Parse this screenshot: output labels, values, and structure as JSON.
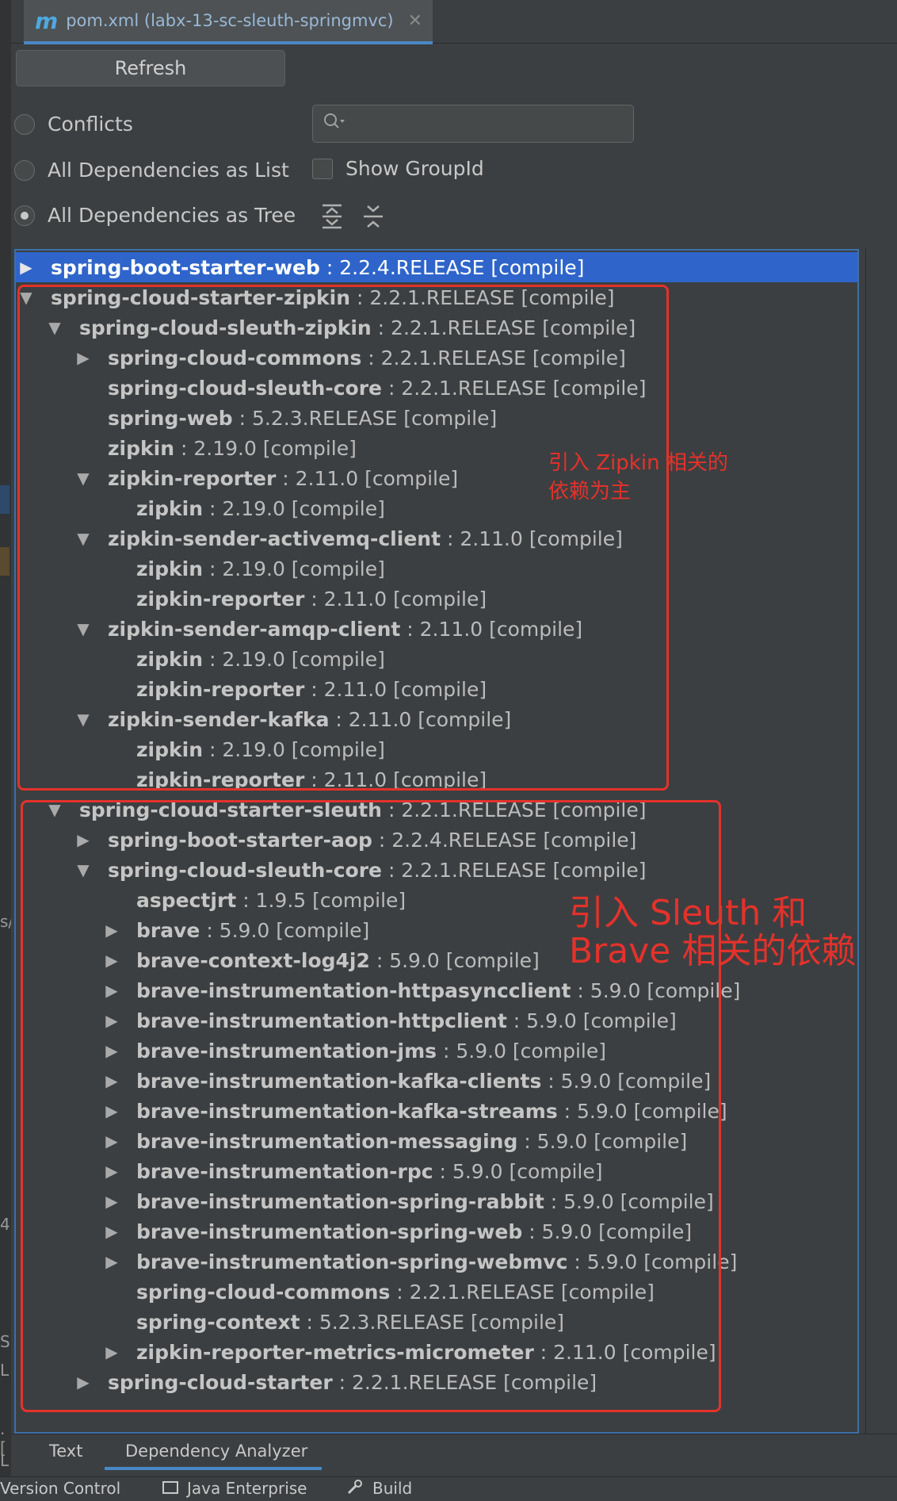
{
  "tab": {
    "icon": "m",
    "title": "pom.xml (labx-13-sc-sleuth-springmvc)",
    "close": "✕"
  },
  "controls": {
    "refresh_label": "Refresh",
    "conflicts_label": "Conflicts",
    "list_label": "All Dependencies as List",
    "tree_label": "All Dependencies as Tree",
    "show_groupid_label": "Show GroupId",
    "search_placeholder": "",
    "selected_mode": "All Dependencies as Tree"
  },
  "tree": [
    {
      "name": "spring-boot-starter-web",
      "version": ": 2.2.4.RELEASE [compile]",
      "arrow": "▶",
      "selected": true
    },
    {
      "name": "spring-cloud-starter-zipkin",
      "version": ": 2.2.1.RELEASE [compile]",
      "arrow": "▼"
    },
    {
      "name": "spring-cloud-sleuth-zipkin",
      "version": ": 2.2.1.RELEASE [compile]",
      "arrow": "▼"
    },
    {
      "name": "spring-cloud-commons",
      "version": ": 2.2.1.RELEASE [compile]",
      "arrow": "▶"
    },
    {
      "name": "spring-cloud-sleuth-core",
      "version": ": 2.2.1.RELEASE [compile]",
      "arrow": ""
    },
    {
      "name": "spring-web",
      "version": ": 5.2.3.RELEASE [compile]",
      "arrow": ""
    },
    {
      "name": "zipkin",
      "version": ": 2.19.0 [compile]",
      "arrow": ""
    },
    {
      "name": "zipkin-reporter",
      "version": ": 2.11.0 [compile]",
      "arrow": "▼"
    },
    {
      "name": "zipkin",
      "version": ": 2.19.0 [compile]",
      "arrow": ""
    },
    {
      "name": "zipkin-sender-activemq-client",
      "version": ": 2.11.0 [compile]",
      "arrow": "▼"
    },
    {
      "name": "zipkin",
      "version": ": 2.19.0 [compile]",
      "arrow": ""
    },
    {
      "name": "zipkin-reporter",
      "version": ": 2.11.0 [compile]",
      "arrow": ""
    },
    {
      "name": "zipkin-sender-amqp-client",
      "version": ": 2.11.0 [compile]",
      "arrow": "▼"
    },
    {
      "name": "zipkin",
      "version": ": 2.19.0 [compile]",
      "arrow": ""
    },
    {
      "name": "zipkin-reporter",
      "version": ": 2.11.0 [compile]",
      "arrow": ""
    },
    {
      "name": "zipkin-sender-kafka",
      "version": ": 2.11.0 [compile]",
      "arrow": "▼"
    },
    {
      "name": "zipkin",
      "version": ": 2.19.0 [compile]",
      "arrow": ""
    },
    {
      "name": "zipkin-reporter",
      "version": ": 2.11.0 [compile]",
      "arrow": ""
    },
    {
      "name": "spring-cloud-starter-sleuth",
      "version": ": 2.2.1.RELEASE [compile]",
      "arrow": "▼"
    },
    {
      "name": "spring-boot-starter-aop",
      "version": ": 2.2.4.RELEASE [compile]",
      "arrow": "▶"
    },
    {
      "name": "spring-cloud-sleuth-core",
      "version": ": 2.2.1.RELEASE [compile]",
      "arrow": "▼"
    },
    {
      "name": "aspectjrt",
      "version": ": 1.9.5 [compile]",
      "arrow": ""
    },
    {
      "name": "brave",
      "version": ": 5.9.0 [compile]",
      "arrow": "▶"
    },
    {
      "name": "brave-context-log4j2",
      "version": ": 5.9.0 [compile]",
      "arrow": "▶"
    },
    {
      "name": "brave-instrumentation-httpasyncclient",
      "version": ": 5.9.0 [compile]",
      "arrow": "▶"
    },
    {
      "name": "brave-instrumentation-httpclient",
      "version": ": 5.9.0 [compile]",
      "arrow": "▶"
    },
    {
      "name": "brave-instrumentation-jms",
      "version": ": 5.9.0 [compile]",
      "arrow": "▶"
    },
    {
      "name": "brave-instrumentation-kafka-clients",
      "version": ": 5.9.0 [compile]",
      "arrow": "▶"
    },
    {
      "name": "brave-instrumentation-kafka-streams",
      "version": ": 5.9.0 [compile]",
      "arrow": "▶"
    },
    {
      "name": "brave-instrumentation-messaging",
      "version": ": 5.9.0 [compile]",
      "arrow": "▶"
    },
    {
      "name": "brave-instrumentation-rpc",
      "version": ": 5.9.0 [compile]",
      "arrow": "▶"
    },
    {
      "name": "brave-instrumentation-spring-rabbit",
      "version": ": 5.9.0 [compile]",
      "arrow": "▶"
    },
    {
      "name": "brave-instrumentation-spring-web",
      "version": ": 5.9.0 [compile]",
      "arrow": "▶"
    },
    {
      "name": "brave-instrumentation-spring-webmvc",
      "version": ": 5.9.0 [compile]",
      "arrow": "▶"
    },
    {
      "name": "spring-cloud-commons",
      "version": ": 2.2.1.RELEASE [compile]",
      "arrow": ""
    },
    {
      "name": "spring-context",
      "version": ": 5.2.3.RELEASE [compile]",
      "arrow": ""
    },
    {
      "name": "zipkin-reporter-metrics-micrometer",
      "version": ": 2.11.0 [compile]",
      "arrow": "▶"
    },
    {
      "name": "spring-cloud-starter",
      "version": ": 2.2.1.RELEASE [compile]",
      "arrow": "▶"
    }
  ],
  "annotations": {
    "zipkin_line1": "引入 Zipkin 相关的",
    "zipkin_line2": "依赖为主",
    "sleuth_line1": "引入 Sleuth 和",
    "sleuth_line2": "Brave 相关的依赖",
    "color": "#e3322b"
  },
  "bottom_tabs": {
    "text": "Text",
    "analyzer": "Dependency Analyzer"
  },
  "status_bar": {
    "version_control": "Version Control",
    "java_enterprise": "Java Enterprise",
    "build": "Build"
  },
  "gutter_chars": [
    "s/",
    "4",
    "S",
    "L",
    ".[",
    "L"
  ],
  "colors": {
    "selection": "#2f65ca",
    "accent": "#4a88c7",
    "background": "#3c3f41"
  }
}
